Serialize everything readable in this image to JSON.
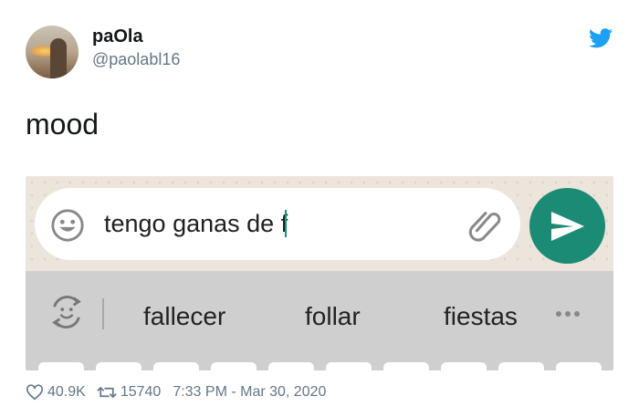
{
  "tweet": {
    "display_name": "paOla",
    "handle": "@paolabl16",
    "text": "mood",
    "likes": "40.9K",
    "retweets": "15740",
    "timestamp": "7:33 PM - Mar 30, 2020"
  },
  "chat_input": {
    "typed_text": "tengo ganas de f"
  },
  "keyboard": {
    "suggestions": [
      "fallecer",
      "follar",
      "fiestas"
    ]
  },
  "colors": {
    "twitter_blue": "#1da1f2",
    "send_button": "#1c8b76",
    "secondary_text": "#657786"
  },
  "icons": [
    "twitter-bird-icon",
    "emoji-icon",
    "attach-icon",
    "send-icon",
    "keyboard-emoji-icon",
    "more-icon",
    "heart-icon",
    "retweet-icon"
  ]
}
